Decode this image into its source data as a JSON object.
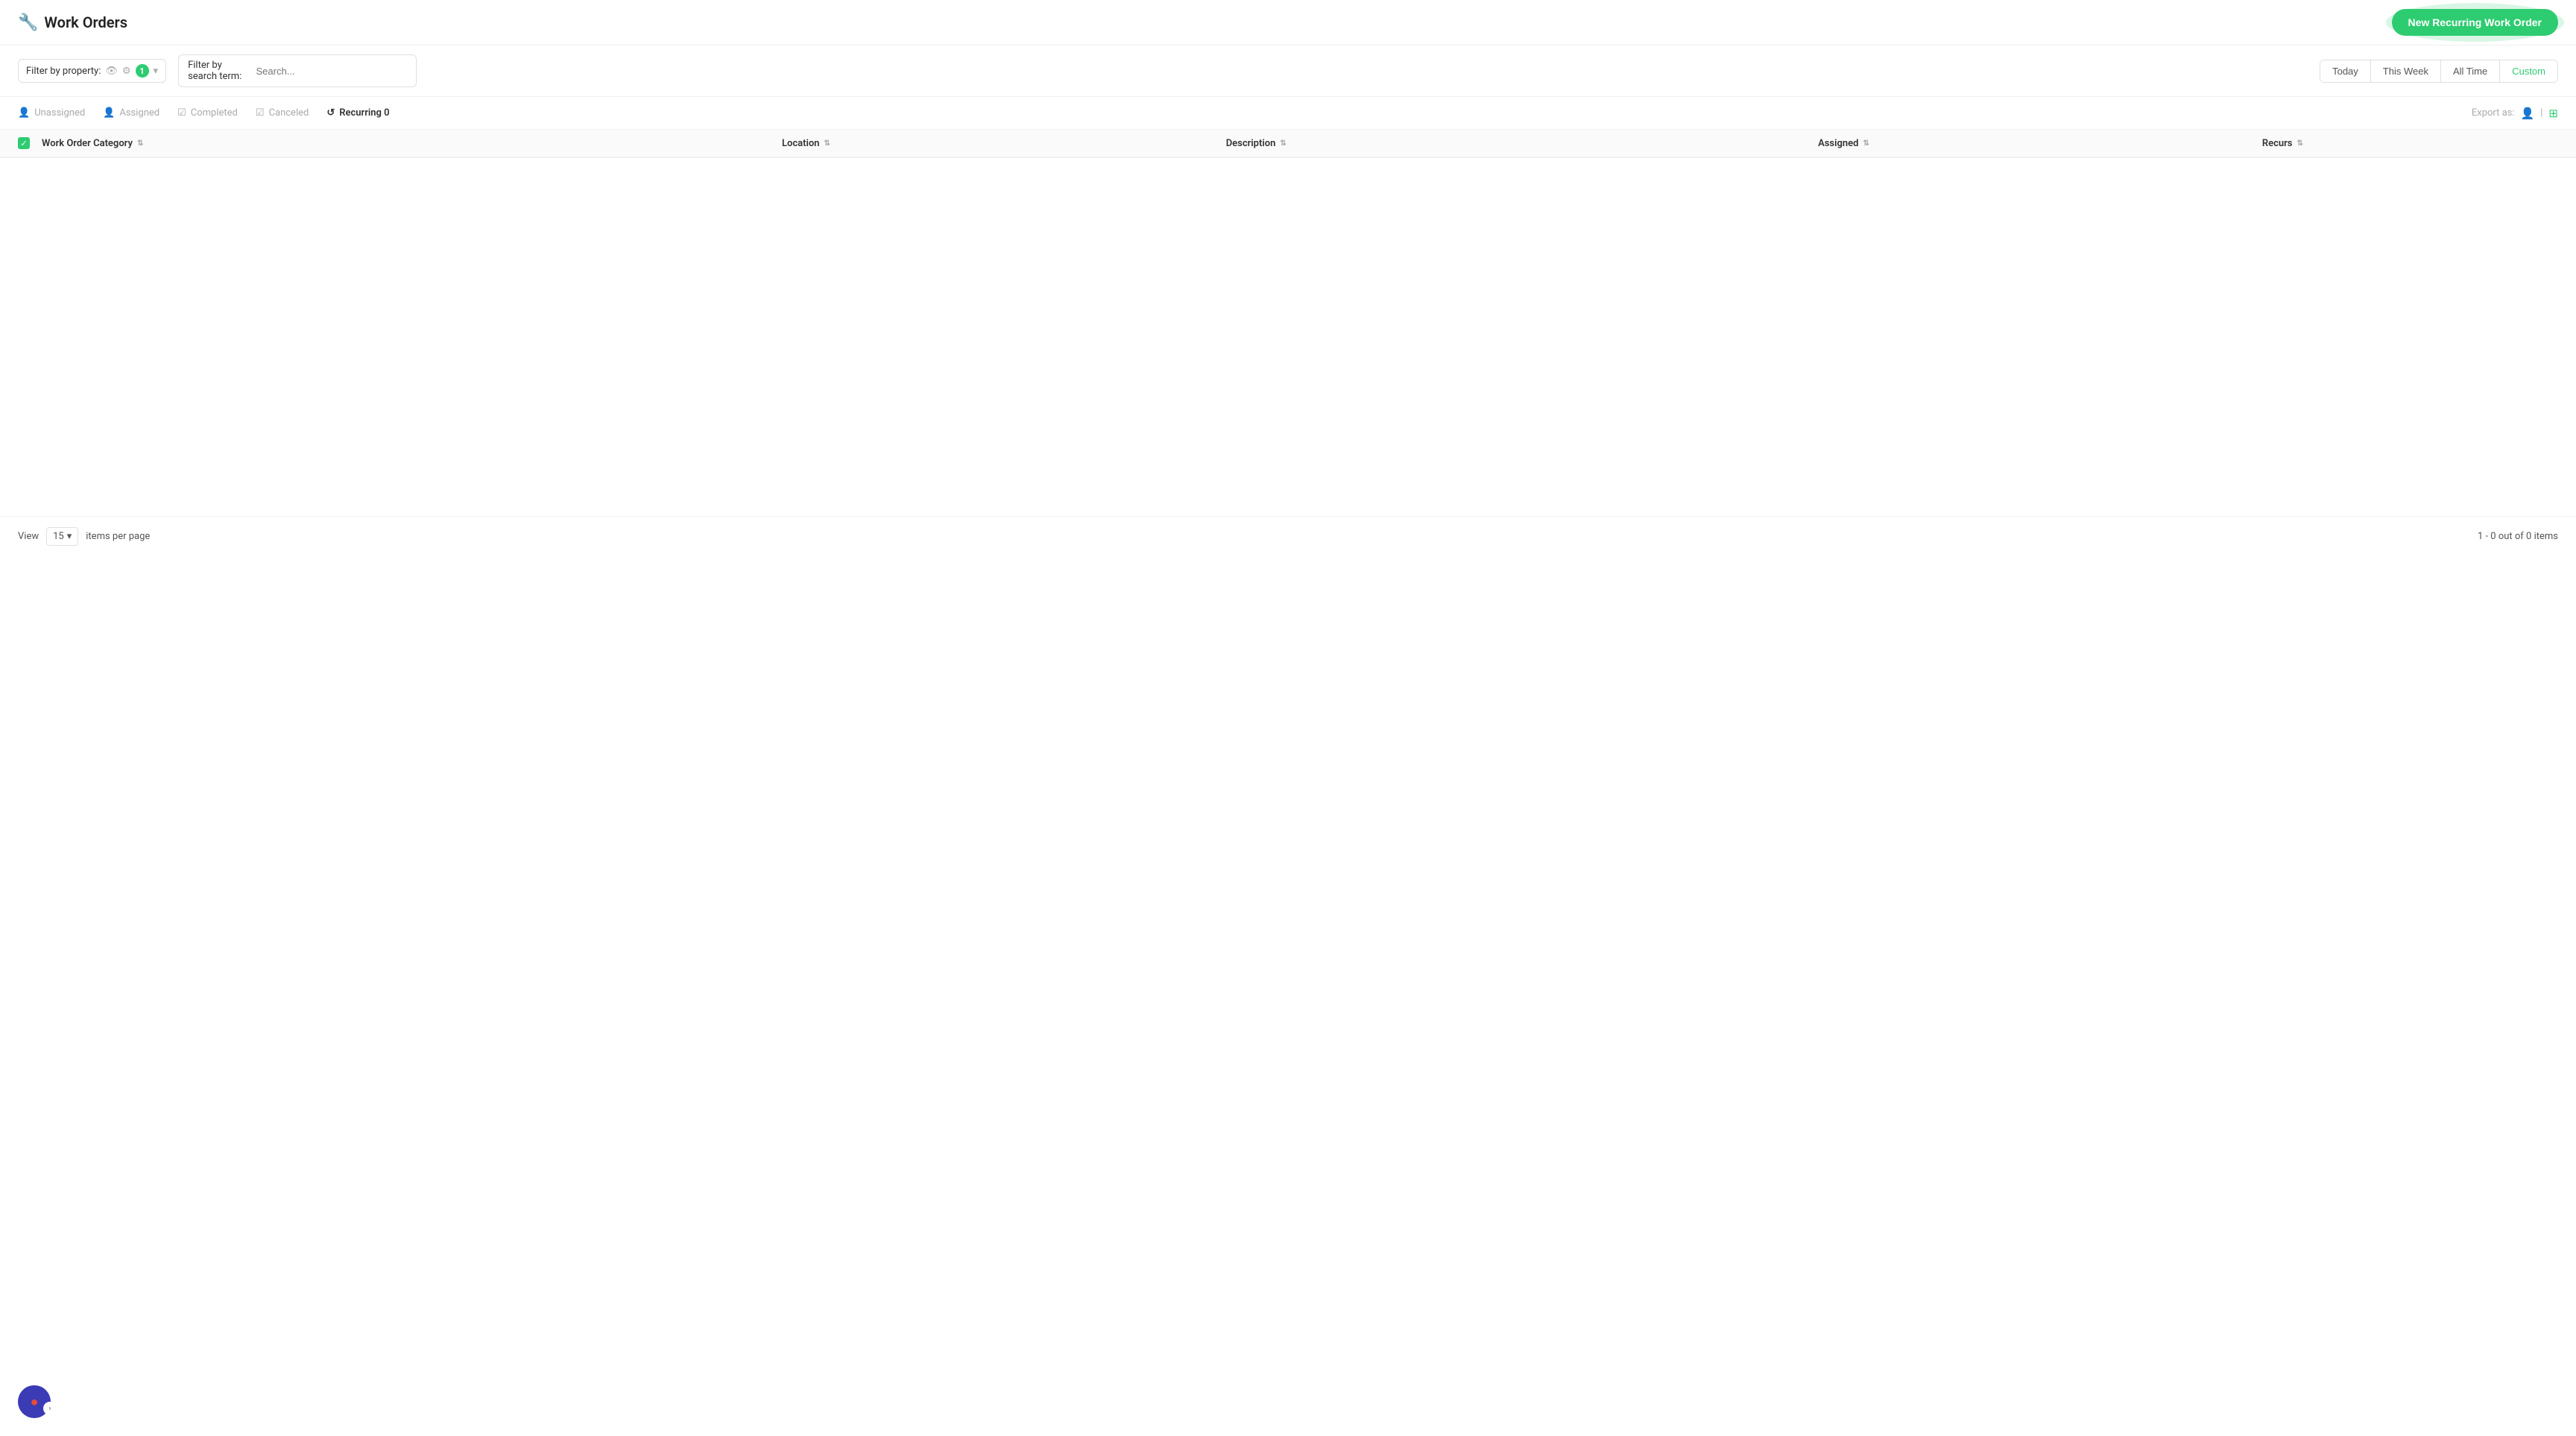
{
  "header": {
    "logo": "🔧",
    "title": "Work Orders",
    "new_button_label": "New Recurring Work Order"
  },
  "toolbar": {
    "filter_property_label": "Filter by property:",
    "filter_badge_count": "1",
    "filter_search_label": "Filter by search term:",
    "filter_search_placeholder": "Search...",
    "date_filters": [
      "Today",
      "This Week",
      "All Time",
      "Custom"
    ],
    "active_date_filter": "Custom"
  },
  "tabs": [
    {
      "key": "unassigned",
      "label": "Unassigned",
      "icon": "👤",
      "active": false
    },
    {
      "key": "assigned",
      "label": "Assigned",
      "icon": "👤",
      "active": false
    },
    {
      "key": "completed",
      "label": "Completed",
      "icon": "☑",
      "active": false
    },
    {
      "key": "canceled",
      "label": "Canceled",
      "icon": "☑",
      "active": false
    },
    {
      "key": "recurring",
      "label": "Recurring 0",
      "icon": "↺",
      "active": true
    }
  ],
  "export": {
    "label": "Export as:"
  },
  "table": {
    "columns": [
      {
        "key": "category",
        "label": "Work Order Category"
      },
      {
        "key": "location",
        "label": "Location"
      },
      {
        "key": "description",
        "label": "Description"
      },
      {
        "key": "assigned",
        "label": "Assigned"
      },
      {
        "key": "recurs",
        "label": "Recurs"
      }
    ],
    "rows": []
  },
  "footer": {
    "view_label": "View",
    "items_per_page": "15",
    "items_per_page_suffix": "items per page",
    "pagination": "1 - 0 out of 0 items"
  }
}
